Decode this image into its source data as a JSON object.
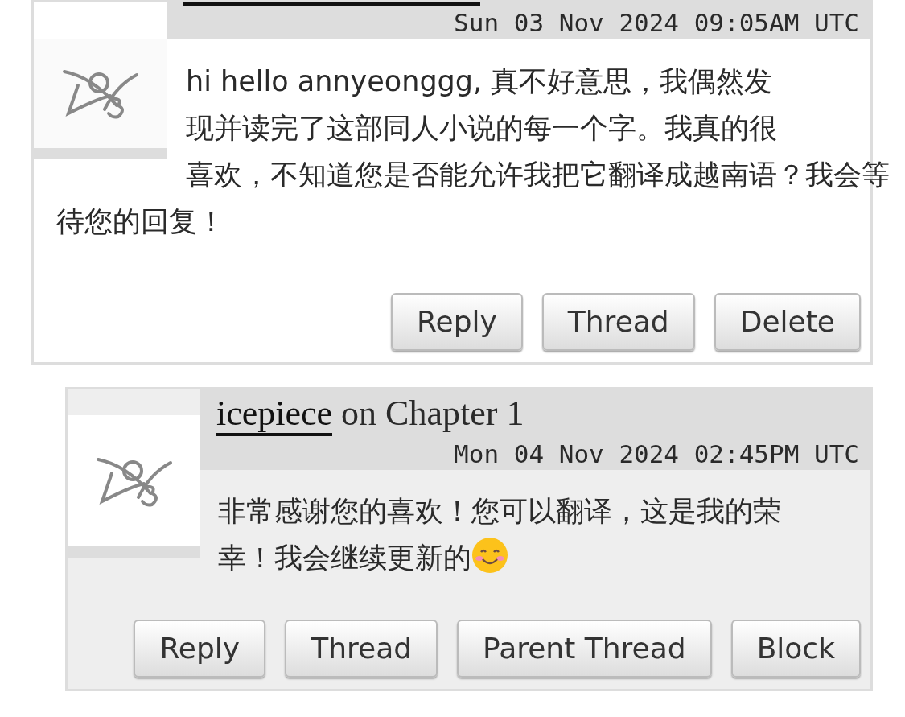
{
  "comments": [
    {
      "timestamp": "Sun 03 Nov 2024 09:05AM UTC",
      "body_lines": [
        "hi hello annyeonggg, 真不好意思，我偶然发",
        "现并读完了这部同人小说的每一个字。我真的很",
        "喜欢，不知道您是否能允许我把它翻译成越南语？我会等",
        "待您的回复！"
      ],
      "buttons": [
        "Reply",
        "Thread",
        "Delete"
      ],
      "replies": [
        {
          "author": "icepiece",
          "chapter": "on Chapter 1",
          "timestamp": "Mon 04 Nov 2024 02:45PM UTC",
          "body_lines": [
            "非常感谢您的喜欢！您可以翻译，这是我的荣",
            "幸！我会继续更新的"
          ],
          "buttons": [
            "Reply",
            "Thread",
            "Parent Thread",
            "Block"
          ]
        }
      ]
    }
  ]
}
